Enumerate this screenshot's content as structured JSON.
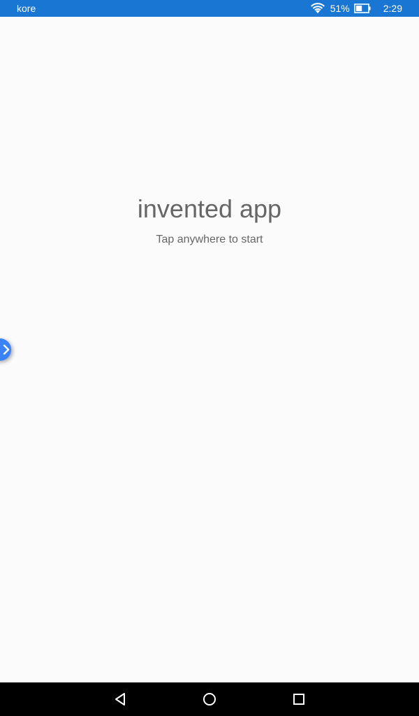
{
  "status_bar": {
    "carrier": "kore",
    "battery_percent": "51%",
    "battery_level": 0.51,
    "time": "2:29",
    "background_color": "#1976d2",
    "icons": [
      "wifi-icon",
      "battery-icon"
    ]
  },
  "main": {
    "title": "invented app",
    "subtitle": "Tap anywhere to start"
  },
  "edge_handle": {
    "icon": "chevron-right-icon",
    "color": "#3b82f6"
  },
  "nav_bar": {
    "buttons": [
      "back-icon",
      "home-icon",
      "recents-icon"
    ]
  }
}
